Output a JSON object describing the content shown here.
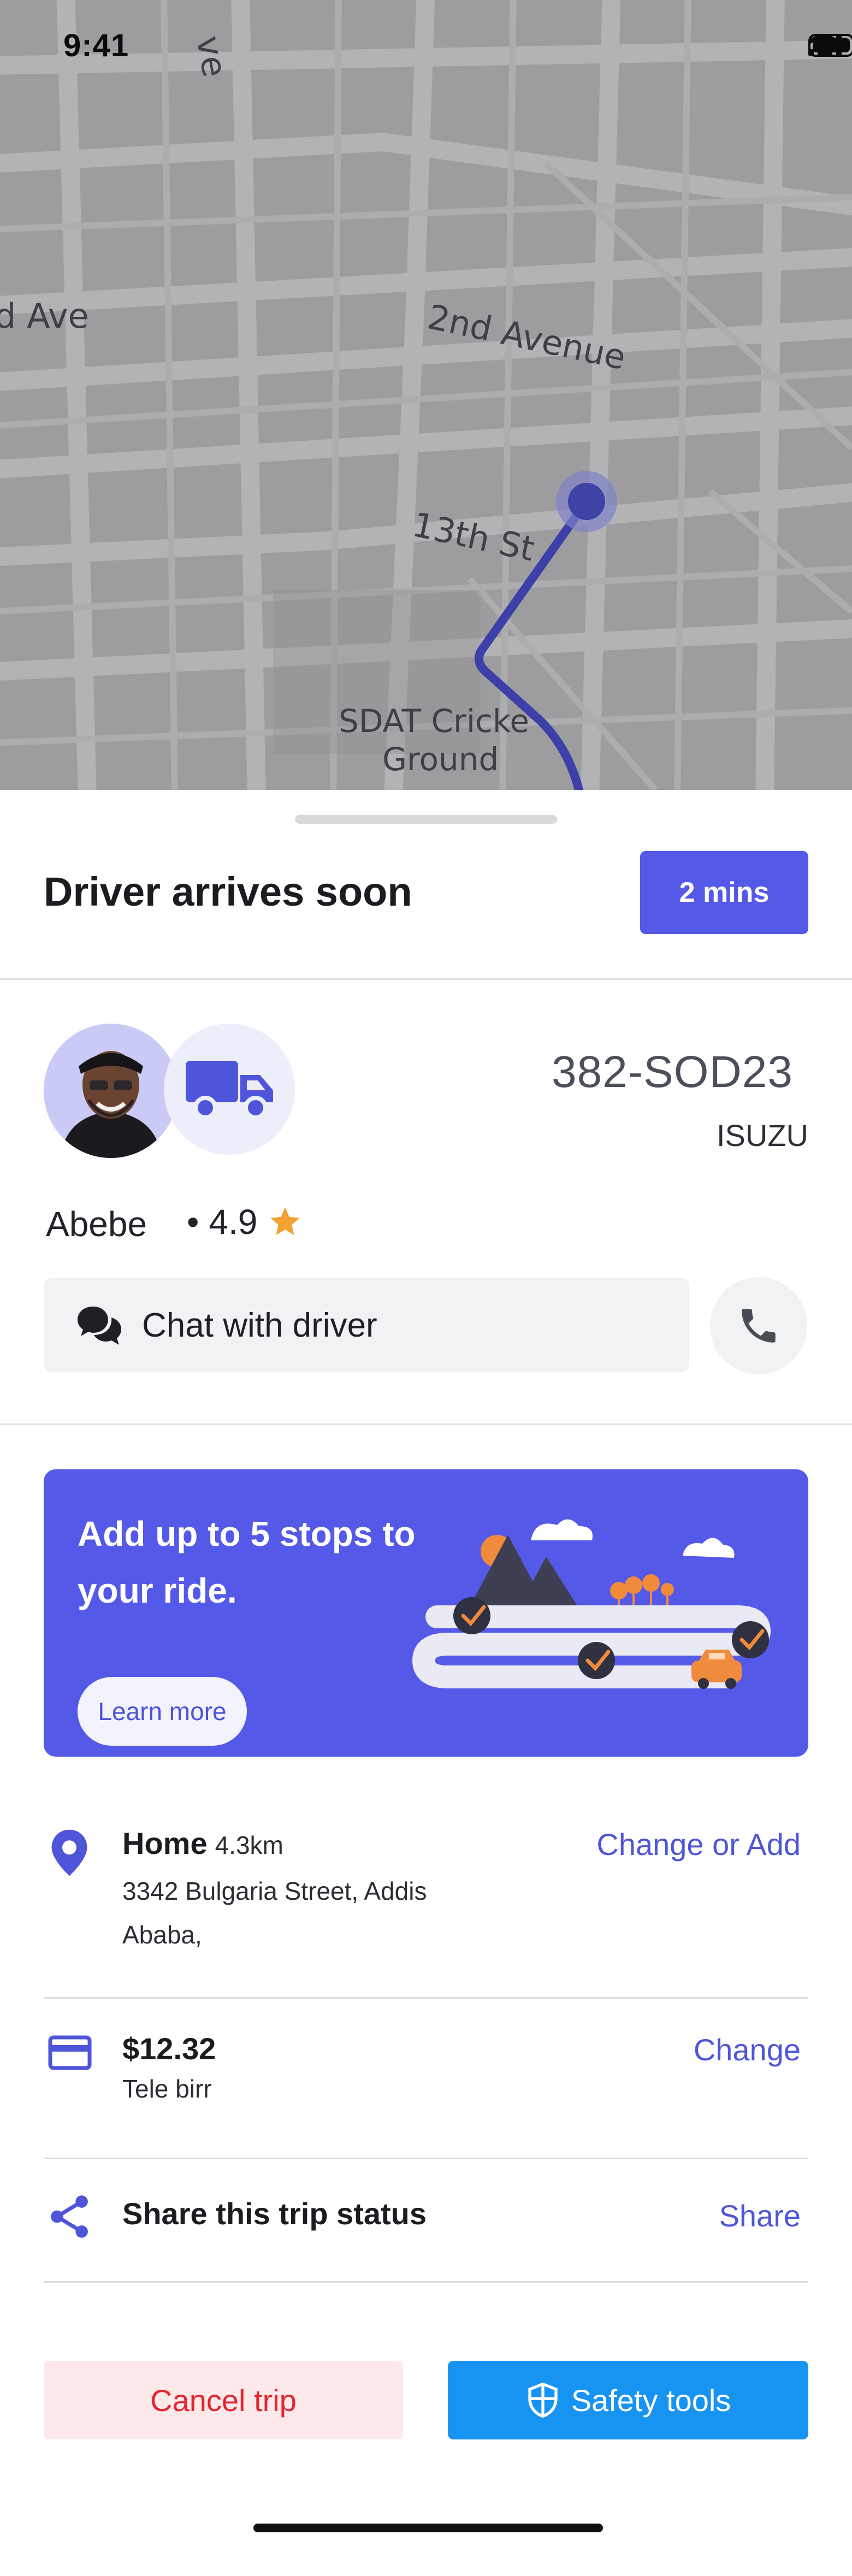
{
  "status_bar": {
    "time": "9:41"
  },
  "map": {
    "street_labels": [
      "ve",
      "d Ave",
      "2nd Avenue",
      "13th St",
      "SDAT Cricke",
      "Ground"
    ],
    "route_color": "#3d40a8",
    "location_dot_color": "#3f43a6"
  },
  "header": {
    "title": "Driver arrives soon",
    "eta": "2 mins"
  },
  "driver": {
    "name": "Abebe",
    "rating_prefix": "•",
    "rating": "4.9",
    "plate": "382-SOD23",
    "vehicle": "ISUZU",
    "vehicle_icon": "truck-icon"
  },
  "actions": {
    "chat_label": "Chat with driver",
    "chat_icon": "chat-bubbles-icon",
    "call_icon": "phone-icon"
  },
  "promo": {
    "text": "Add up to 5 stops to your ride.",
    "button": "Learn more"
  },
  "trip": {
    "destination": {
      "title": "Home",
      "distance": "4.3km",
      "address_line1": "3342 Bulgaria Street, Addis",
      "address_line2": "Ababa,",
      "action": "Change or Add"
    },
    "payment": {
      "amount": "$12.32",
      "method": "Tele birr",
      "action": "Change"
    },
    "share": {
      "title": "Share this trip status",
      "action": "Share"
    }
  },
  "footer": {
    "cancel": "Cancel trip",
    "safety": "Safety tools"
  },
  "colors": {
    "accent": "#5459e8",
    "danger": "#e3262e",
    "danger_bg": "#fde9ea",
    "safety": "#1794f2"
  }
}
